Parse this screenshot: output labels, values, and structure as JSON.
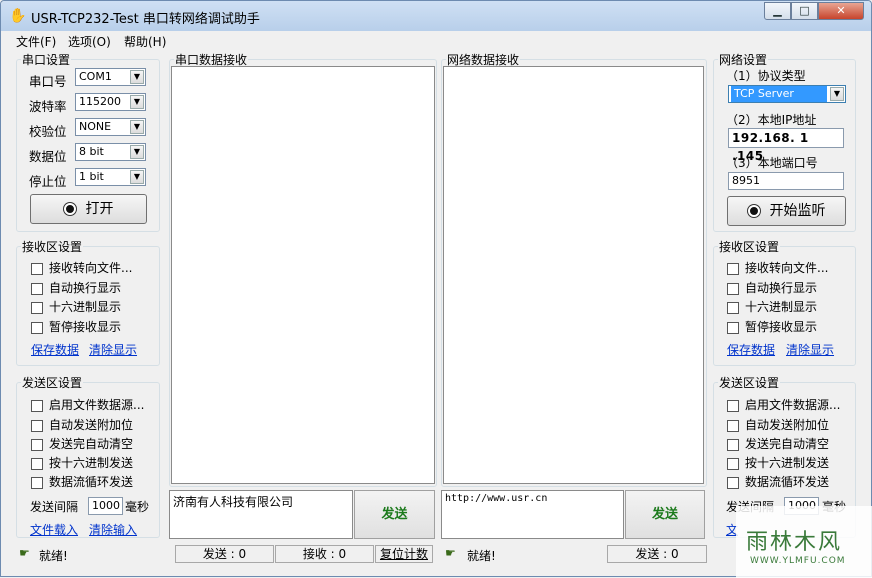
{
  "window": {
    "title": "USR-TCP232-Test 串口转网络调试助手"
  },
  "menu": [
    "文件(F)",
    "选项(O)",
    "帮助(H)"
  ],
  "serial": {
    "legend": "串口设置",
    "port_label": "串口号",
    "port_value": "COM1",
    "baud_label": "波特率",
    "baud_value": "115200",
    "parity_label": "校验位",
    "parity_value": "NONE",
    "data_label": "数据位",
    "data_value": "8 bit",
    "stop_label": "停止位",
    "stop_value": "1 bit",
    "open_button": "打开"
  },
  "recv_left": {
    "legend": "接收区设置",
    "options": [
      "接收转向文件...",
      "自动换行显示",
      "十六进制显示",
      "暂停接收显示"
    ],
    "save_link": "保存数据",
    "clear_link": "清除显示"
  },
  "send_left": {
    "legend": "发送区设置",
    "options": [
      "启用文件数据源...",
      "自动发送附加位",
      "发送完自动清空",
      "按十六进制发送",
      "数据流循环发送"
    ],
    "interval_label": "发送间隔",
    "interval_value": "1000",
    "interval_unit": "毫秒",
    "load_link": "文件载入",
    "clear_link": "清除输入"
  },
  "serial_recv": {
    "legend": "串口数据接收"
  },
  "net_recv": {
    "legend": "网络数据接收"
  },
  "serial_send": {
    "text": "济南有人科技有限公司",
    "button": "发送"
  },
  "net_send": {
    "text": "http://www.usr.cn",
    "button": "发送"
  },
  "network": {
    "legend": "网络设置",
    "protocol_label": "（1）协议类型",
    "protocol_value": "TCP Server",
    "ip_label": "（2）本地IP地址",
    "ip_value": "192.168. 1 .145",
    "port_label": "（3）本地端口号",
    "port_value": "8951",
    "listen_button": "开始监听"
  },
  "recv_right": {
    "legend": "接收区设置",
    "options": [
      "接收转向文件...",
      "自动换行显示",
      "十六进制显示",
      "暂停接收显示"
    ],
    "save_link": "保存数据",
    "clear_link": "清除显示"
  },
  "send_right": {
    "legend": "发送区设置",
    "options": [
      "启用文件数据源...",
      "自动发送附加位",
      "发送完自动清空",
      "按十六进制发送",
      "数据流循环发送"
    ],
    "interval_label": "发送间隔",
    "interval_value": "1000",
    "interval_unit": "毫秒",
    "load_link": "文"
  },
  "status": {
    "left_text": "就绪!",
    "sent_left": "发送 : 0",
    "recv_left": "接收 : 0",
    "reset": "复位计数",
    "right_text": "就绪!",
    "sent_right": "发送 : 0"
  },
  "watermark": {
    "text": "雨林木风",
    "url": "WWW.YLMFU.COM"
  }
}
